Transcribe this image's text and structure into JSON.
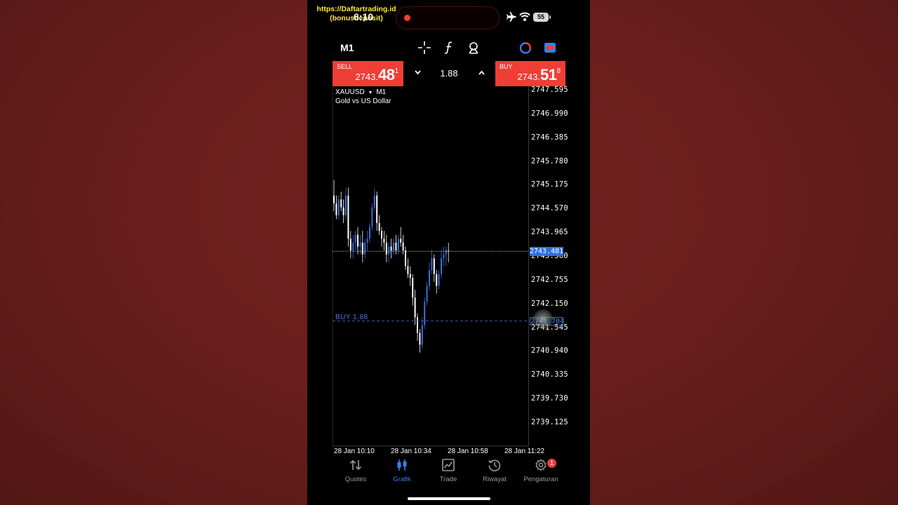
{
  "status_bar": {
    "watermark_line1": "https://Daftartrading.id",
    "watermark_line2": "(bonusdeposit)",
    "time": "6:10",
    "battery": "55"
  },
  "toolbar": {
    "timeframe": "M1",
    "icons": [
      "crosshair-icon",
      "indicator-f-icon",
      "objects-icon",
      "trading-signal-icon",
      "one-click-trading-icon"
    ]
  },
  "trade_bar": {
    "sell_label": "SELL",
    "sell_price_main": "2743.",
    "sell_price_big": "48",
    "sell_price_sup": "1",
    "buy_label": "BUY",
    "buy_price_main": "2743.",
    "buy_price_big": "51",
    "buy_price_sup": "8",
    "lot": "1.88"
  },
  "chart": {
    "symbol": "XAUUSD",
    "symbol_timeframe": "M1",
    "description": "Gold vs US Dollar",
    "current_price_label": "2743.481",
    "order_label": "BUY 1.88",
    "order_price_label": "2741.704",
    "colors": {
      "up": "#3b6fd8",
      "down": "#ffffff",
      "price_tag": "#2f6fe0",
      "order": "#4d7ae0"
    }
  },
  "chart_data": {
    "type": "candlestick",
    "symbol": "XAUUSD",
    "timeframe": "M1",
    "y_ticks": [
      "2747.595",
      "2746.990",
      "2746.385",
      "2745.780",
      "2745.175",
      "2744.570",
      "2743.965",
      "2743.360",
      "2742.755",
      "2742.150",
      "2741.545",
      "2740.940",
      "2740.335",
      "2739.730",
      "2739.125"
    ],
    "x_ticks": [
      "28 Jan 10:10",
      "28 Jan 10:34",
      "28 Jan 10:58",
      "28 Jan 11:22"
    ],
    "ylim": [
      2738.85,
      2747.87
    ],
    "current_price": 2743.481,
    "order_price": 2741.704,
    "candles": [
      [
        2744.9,
        2745.3,
        2744.5,
        2744.7
      ],
      [
        2744.7,
        2744.9,
        2744.3,
        2744.4
      ],
      [
        2744.4,
        2744.9,
        2744.3,
        2744.8
      ],
      [
        2744.8,
        2745.0,
        2744.5,
        2744.6
      ],
      [
        2744.6,
        2744.8,
        2744.2,
        2744.4
      ],
      [
        2744.4,
        2745.1,
        2744.3,
        2744.9
      ],
      [
        2744.9,
        2745.1,
        2743.6,
        2743.8
      ],
      [
        2743.8,
        2744.0,
        2743.3,
        2743.5
      ],
      [
        2743.5,
        2743.9,
        2743.3,
        2743.7
      ],
      [
        2743.7,
        2744.0,
        2743.5,
        2743.9
      ],
      [
        2743.9,
        2744.1,
        2743.4,
        2743.6
      ],
      [
        2743.6,
        2743.9,
        2743.4,
        2743.7
      ],
      [
        2743.7,
        2744.0,
        2743.2,
        2743.4
      ],
      [
        2743.4,
        2743.8,
        2743.3,
        2743.7
      ],
      [
        2743.7,
        2744.0,
        2743.5,
        2743.8
      ],
      [
        2743.8,
        2744.2,
        2743.7,
        2744.1
      ],
      [
        2744.1,
        2744.7,
        2744.0,
        2744.6
      ],
      [
        2744.6,
        2745.1,
        2744.5,
        2744.9
      ],
      [
        2744.9,
        2745.0,
        2744.0,
        2744.2
      ],
      [
        2744.2,
        2744.4,
        2743.9,
        2744.0
      ],
      [
        2744.0,
        2744.1,
        2743.6,
        2743.8
      ],
      [
        2743.8,
        2744.0,
        2743.5,
        2743.7
      ],
      [
        2743.7,
        2743.9,
        2743.2,
        2743.4
      ],
      [
        2743.4,
        2743.7,
        2743.2,
        2743.6
      ],
      [
        2743.6,
        2743.8,
        2743.3,
        2743.5
      ],
      [
        2743.5,
        2743.8,
        2743.4,
        2743.7
      ],
      [
        2743.7,
        2743.9,
        2743.4,
        2743.5
      ],
      [
        2743.5,
        2743.9,
        2743.4,
        2743.8
      ],
      [
        2743.8,
        2744.1,
        2743.6,
        2743.7
      ],
      [
        2743.7,
        2743.9,
        2743.4,
        2743.5
      ],
      [
        2743.5,
        2743.6,
        2743.0,
        2743.1
      ],
      [
        2743.1,
        2743.3,
        2742.8,
        2742.9
      ],
      [
        2742.9,
        2743.1,
        2742.6,
        2742.8
      ],
      [
        2742.8,
        2742.9,
        2742.1,
        2742.3
      ],
      [
        2742.3,
        2742.5,
        2741.6,
        2741.8
      ],
      [
        2741.8,
        2741.9,
        2741.2,
        2741.4
      ],
      [
        2741.4,
        2741.5,
        2740.9,
        2741.1
      ],
      [
        2741.1,
        2741.8,
        2741.0,
        2741.6
      ],
      [
        2741.6,
        2742.3,
        2741.5,
        2742.2
      ],
      [
        2742.2,
        2742.7,
        2742.1,
        2742.6
      ],
      [
        2742.6,
        2743.2,
        2742.5,
        2743.0
      ],
      [
        2743.0,
        2743.5,
        2742.9,
        2743.3
      ],
      [
        2743.3,
        2743.4,
        2742.7,
        2742.9
      ],
      [
        2742.9,
        2743.0,
        2742.4,
        2742.6
      ],
      [
        2742.6,
        2743.0,
        2742.5,
        2742.9
      ],
      [
        2742.9,
        2743.5,
        2742.8,
        2743.3
      ],
      [
        2743.3,
        2743.6,
        2743.1,
        2743.4
      ],
      [
        2743.4,
        2743.6,
        2743.1,
        2743.5
      ],
      [
        2743.5,
        2743.7,
        2743.2,
        2743.48
      ]
    ]
  },
  "nav": {
    "items": [
      {
        "label": "Quotes",
        "icon": "quotes-icon",
        "active": false
      },
      {
        "label": "Grafik",
        "icon": "chart-icon",
        "active": true
      },
      {
        "label": "Trade",
        "icon": "trade-icon",
        "active": false
      },
      {
        "label": "Riwayat",
        "icon": "history-icon",
        "active": false
      },
      {
        "label": "Pengaturan",
        "icon": "settings-icon",
        "active": false
      }
    ],
    "badge": "1"
  }
}
